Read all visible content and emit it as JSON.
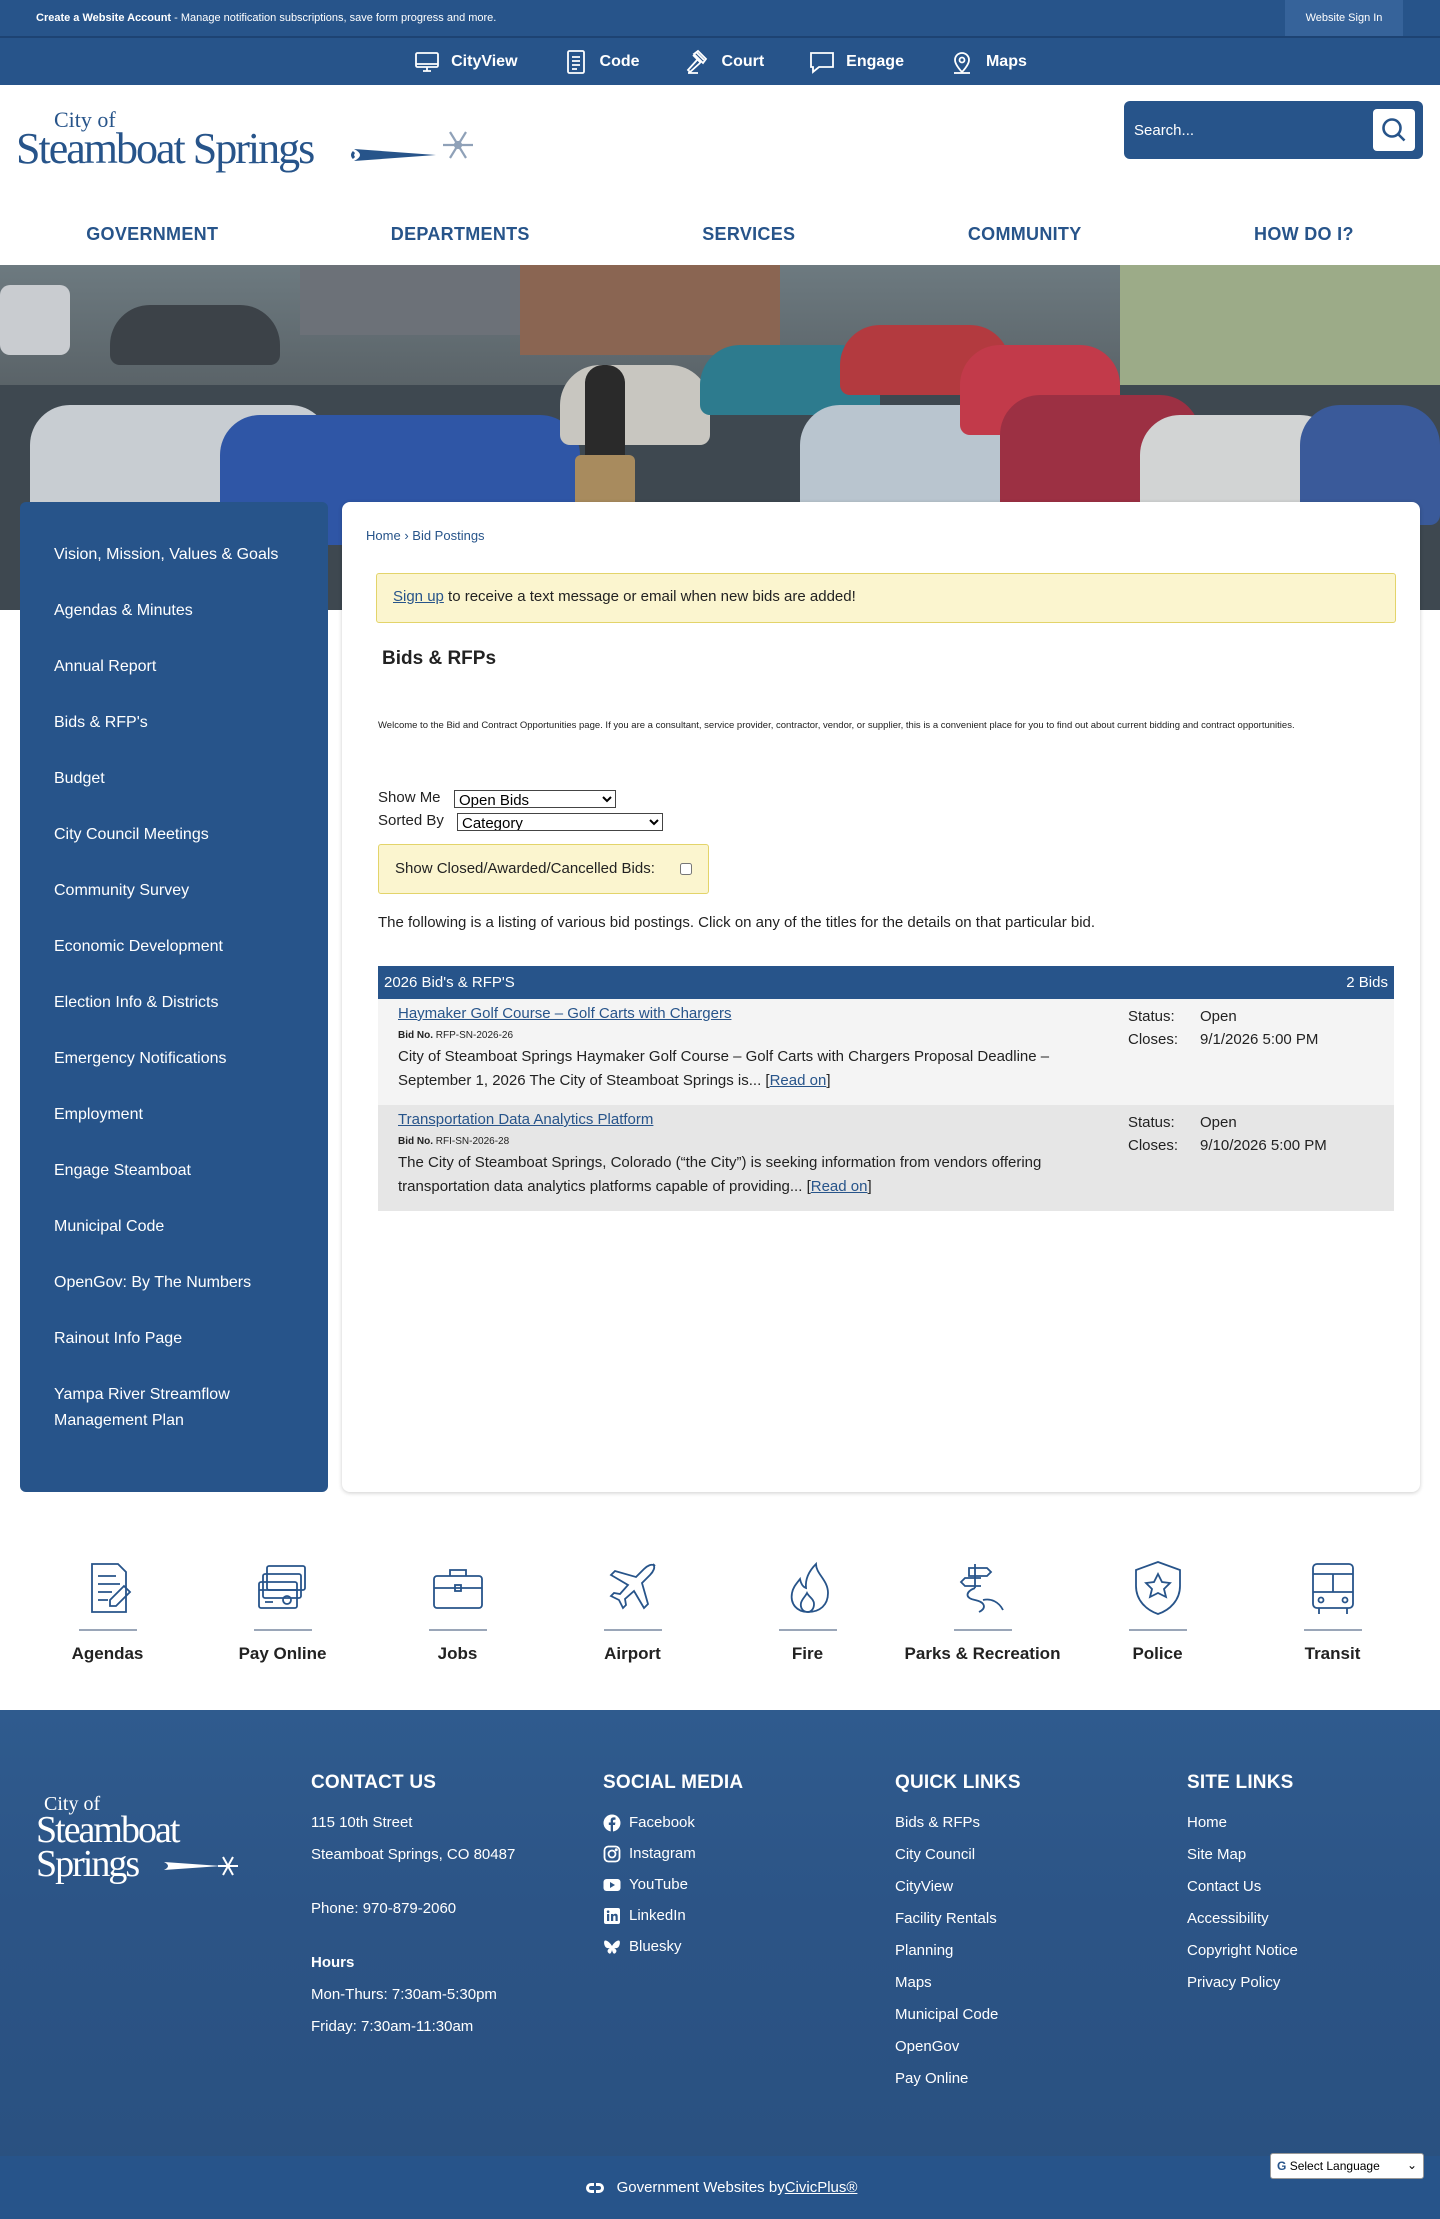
{
  "topbar": {
    "create_label": "Create a Website Account",
    "create_text": " - Manage notification subscriptions, save form progress and more.",
    "signin_label": "Website Sign In"
  },
  "utility_nav": [
    {
      "label": "CityView",
      "icon": "monitor-icon"
    },
    {
      "label": "Code",
      "icon": "document-icon"
    },
    {
      "label": "Court",
      "icon": "gavel-icon"
    },
    {
      "label": "Engage",
      "icon": "chat-icon"
    },
    {
      "label": "Maps",
      "icon": "map-pin-icon"
    }
  ],
  "logo": {
    "city_of": "City of",
    "name": "Steamboat Springs"
  },
  "search": {
    "placeholder": "Search..."
  },
  "main_nav": [
    "GOVERNMENT",
    "DEPARTMENTS",
    "SERVICES",
    "COMMUNITY",
    "HOW DO I?"
  ],
  "sidebar": {
    "items": [
      "Vision, Mission, Values & Goals",
      "Agendas & Minutes",
      "Annual Report",
      "Bids & RFP's",
      "Budget",
      "City Council Meetings",
      "Community Survey",
      "Economic Development",
      "Election Info & Districts",
      "Emergency Notifications",
      "Employment",
      "Engage Steamboat",
      "Municipal Code",
      "OpenGov: By The Numbers",
      "Rainout Info Page",
      "Yampa River Streamflow Management Plan"
    ]
  },
  "breadcrumb": {
    "home": "Home",
    "sep": "›",
    "current": "Bid Postings"
  },
  "notice": {
    "link": "Sign up",
    "text": " to receive a text message or email when new bids are added!"
  },
  "page_title": "Bids & RFPs",
  "intro": "Welcome to the Bid and Contract Opportunities page. If you are a consultant, service provider, contractor, vendor, or supplier, this is a convenient place for you to find out about current bidding and contract opportunities.",
  "filters": {
    "show_me_label": "Show Me",
    "show_me_value": "Open Bids",
    "sorted_by_label": "Sorted By",
    "sorted_by_value": "Category",
    "closed_label": "Show Closed/Awarded/Cancelled Bids:"
  },
  "listing_text": "The following is a listing of various bid postings. Click on any of the titles for the details on that particular bid.",
  "bid_category": {
    "title": "2026 Bid's & RFP'S",
    "count": "2 Bids"
  },
  "bids": [
    {
      "title": "Haymaker Golf Course – Golf Carts with Chargers",
      "bid_no_label": "Bid No.",
      "bid_no": "RFP-SN-2026-26",
      "desc": "City of Steamboat Springs Haymaker Golf Course – Golf Carts with Chargers Proposal Deadline – September 1, 2026 The City of Steamboat Springs is... ",
      "read_on": "Read on",
      "status_label": "Status:",
      "status": "Open",
      "closes_label": "Closes:",
      "closes": "9/1/2026 5:00 PM"
    },
    {
      "title": "Transportation Data Analytics Platform",
      "bid_no_label": "Bid No.",
      "bid_no": "RFI-SN-2026-28",
      "desc": "The City of Steamboat Springs, Colorado (“the City”) is seeking information from vendors offering transportation data analytics platforms capable of providing... ",
      "read_on": "Read on",
      "status_label": "Status:",
      "status": "Open",
      "closes_label": "Closes:",
      "closes": "9/10/2026 5:00 PM"
    }
  ],
  "quick_links": [
    {
      "label": "Agendas",
      "icon": "agenda-icon"
    },
    {
      "label": "Pay Online",
      "icon": "payment-icon"
    },
    {
      "label": "Jobs",
      "icon": "briefcase-icon"
    },
    {
      "label": "Airport",
      "icon": "airplane-icon"
    },
    {
      "label": "Fire",
      "icon": "flame-icon"
    },
    {
      "label": "Parks & Recreation",
      "icon": "trail-sign-icon"
    },
    {
      "label": "Police",
      "icon": "badge-icon"
    },
    {
      "label": "Transit",
      "icon": "bus-icon"
    }
  ],
  "footer": {
    "contact": {
      "heading": "CONTACT US",
      "street": "115 10th Street",
      "city": "Steamboat Springs, CO 80487",
      "phone": "Phone: 970-879-2060",
      "hours_heading": "Hours",
      "hours1": "Mon-Thurs: 7:30am-5:30pm",
      "hours2": "Friday: 7:30am-11:30am"
    },
    "social": {
      "heading": "SOCIAL MEDIA",
      "items": [
        "Facebook",
        "Instagram",
        "YouTube",
        "LinkedIn",
        "Bluesky"
      ]
    },
    "quick": {
      "heading": "QUICK LINKS",
      "items": [
        "Bids & RFPs",
        "City Council",
        "CityView",
        "Facility Rentals",
        "Planning",
        "Maps",
        "Municipal Code",
        "OpenGov",
        "Pay Online"
      ]
    },
    "site": {
      "heading": "SITE LINKS",
      "items": [
        "Home",
        "Site Map",
        "Contact Us",
        "Accessibility",
        "Copyright Notice",
        "Privacy Policy"
      ]
    },
    "credit_text": "Government Websites by ",
    "credit_link": "CivicPlus®",
    "language": "Select Language"
  },
  "colors": {
    "brand_blue": "#27548a",
    "notice_yellow": "#fbf5cf"
  }
}
